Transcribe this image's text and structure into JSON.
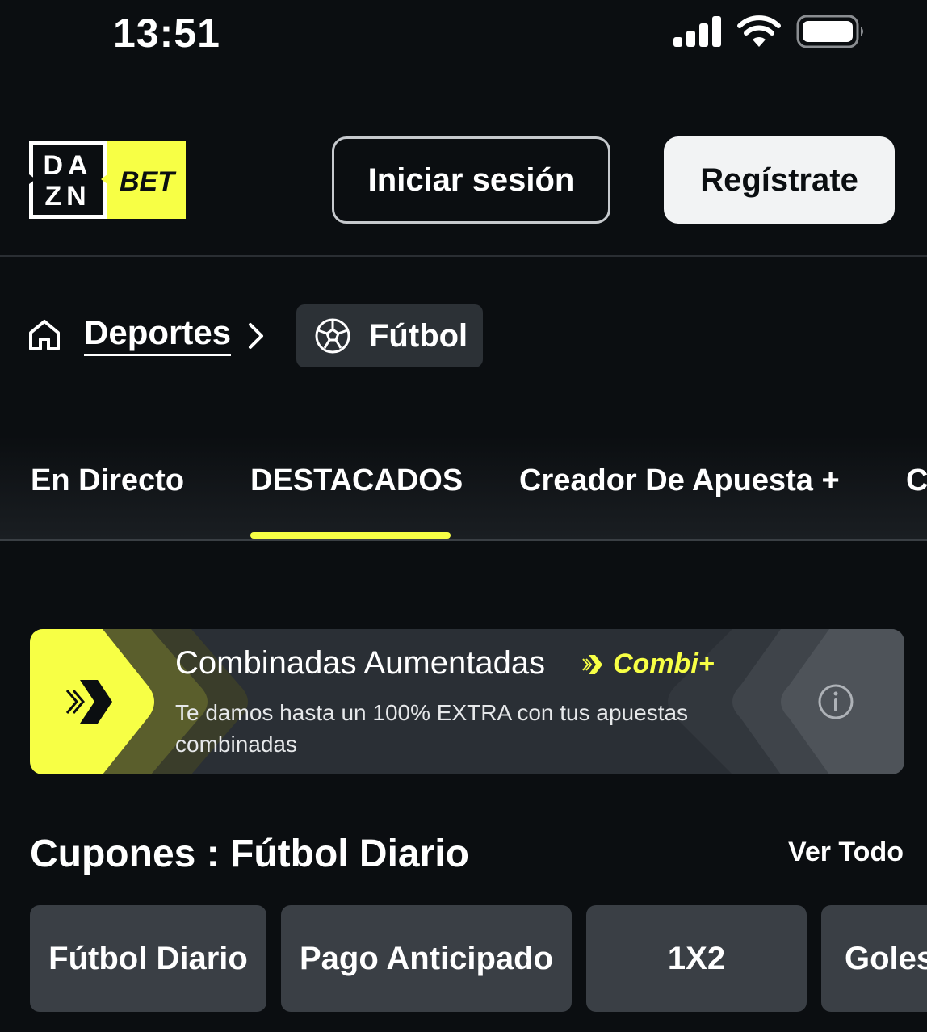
{
  "status_bar": {
    "time": "13:51"
  },
  "header": {
    "logo_top": "DA",
    "logo_bottom": "ZN",
    "logo_bet": "BET",
    "login_label": "Iniciar sesión",
    "register_label": "Regístrate"
  },
  "breadcrumb": {
    "parent_label": "Deportes",
    "current_label": "Fútbol"
  },
  "tabs": {
    "items": [
      {
        "label": "En Directo"
      },
      {
        "label": "DESTACADOS"
      },
      {
        "label": "Creador De Apuesta +"
      },
      {
        "label": "C"
      }
    ],
    "active_index": 1
  },
  "promo": {
    "title": "Combinadas Aumentadas",
    "brand": "Combi+",
    "description": "Te damos hasta un 100% EXTRA con tus apuestas combinadas",
    "accent_color": "#f7ff45"
  },
  "section": {
    "title": "Cupones : Fútbol Diario",
    "see_all": "Ver Todo"
  },
  "chips": [
    {
      "label": "Fútbol Diario"
    },
    {
      "label": "Pago Anticipado"
    },
    {
      "label": "1X2"
    },
    {
      "label": "Goles"
    }
  ]
}
